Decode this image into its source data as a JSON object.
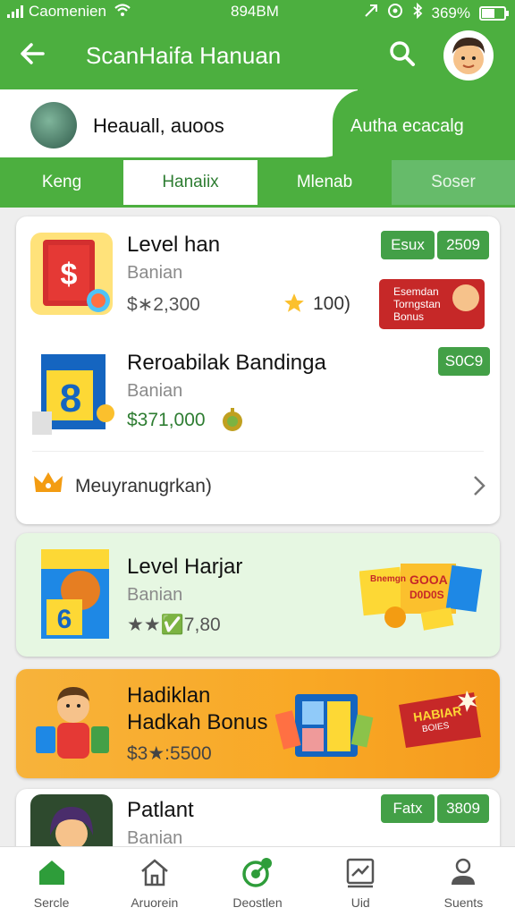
{
  "status_bar": {
    "carrier": "Caomenien",
    "time": "894BM",
    "battery": "369%"
  },
  "header": {
    "title": "ScanHaifa Hanuan"
  },
  "user": {
    "name": "Heauall, auoos",
    "link": "Autha ecacalg"
  },
  "tabs": [
    "Keng",
    "Hanaiix",
    "Mlenab",
    "Soser"
  ],
  "items": [
    {
      "name": "Level han",
      "subtitle": "Banian",
      "price": "$∗2,300",
      "rating": "100)",
      "badge_left": "Esux",
      "badge_right": "2509",
      "bonus": [
        "Esemdan",
        "Torngstan",
        "Bonus"
      ]
    },
    {
      "name": "Reroabilak Bandinga",
      "subtitle": "Banian",
      "price": "$371,000",
      "badge": "S0C9"
    },
    {
      "name": "Level Harjar",
      "subtitle": "Banian",
      "price": "★★✅7,80"
    },
    {
      "name": "Hadiklan\nHadkah Bonus",
      "name_line1": "Hadiklan",
      "name_line2": "Hadkah Bonus",
      "price": "$3★:5500",
      "tag": "HABIAR",
      "tag_sub": "BOIES"
    },
    {
      "name": "Patlant",
      "subtitle": "Banian",
      "badge_left": "Fatx",
      "badge_right": "3809"
    }
  ],
  "more": {
    "label": "Meuyranugrkan)"
  },
  "promo_text": [
    "Bnemgn",
    "GOOA",
    "D0D0S"
  ],
  "nav": [
    "Sercle",
    "Aruorein",
    "Deostlen",
    "Uid",
    "Suents"
  ],
  "colors": {
    "primary_green": "#4caf3f",
    "badge_green": "#43a047",
    "bonus_red": "#c62828",
    "orange_card": "#f9a825"
  }
}
